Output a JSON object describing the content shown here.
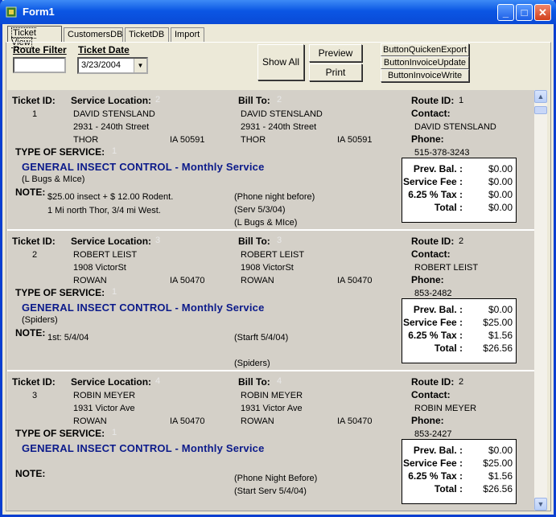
{
  "window": {
    "title": "Form1"
  },
  "tabs": [
    {
      "label": "Ticket View"
    },
    {
      "label": "CustomersDB"
    },
    {
      "label": "TicketDB"
    },
    {
      "label": "Import"
    }
  ],
  "filters": {
    "route_filter_label": "Route Filter",
    "route_filter_value": "",
    "ticket_date_label": "Ticket Date",
    "ticket_date_value": "3/23/2004"
  },
  "buttons": {
    "show_all": "Show All",
    "preview": "Preview",
    "print": "Print",
    "quicken_export": "ButtonQuickenExport",
    "invoice_update": "ButtonInvoiceUpdate",
    "invoice_write": "ButtonInvoiceWrite"
  },
  "labels": {
    "ticket_id": "Ticket ID:",
    "service_location": "Service Location:",
    "bill_to": "Bill To:",
    "route_id": "Route ID:",
    "contact": "Contact:",
    "phone": "Phone:",
    "type_of_service": "TYPE OF SERVICE:",
    "note": "NOTE:",
    "prev_bal": "Prev. Bal. :",
    "service_fee": "Service Fee :",
    "tax": "6.25 % Tax :",
    "total": "Total :"
  },
  "tickets": [
    {
      "ticket_id": "1",
      "loc_code": "2",
      "bill_code": "2",
      "route_id": "1",
      "loc_name": "DAVID STENSLAND",
      "loc_street": "2931 - 240th Street",
      "loc_city": "THOR",
      "loc_state_zip": "IA  50591",
      "bill_name": "DAVID STENSLAND",
      "bill_street": "2931 - 240th Street",
      "bill_city": "THOR",
      "bill_state_zip": "IA  50591",
      "contact": "DAVID STENSLAND",
      "phone": "515-378-3243",
      "service_code": "1",
      "service": "GENERAL INSECT CONTROL - Monthly Service",
      "pests": "(L Bugs & MIce)",
      "note_1": "$25.00 insect + $ 12.00 Rodent.",
      "note_2": "1 Mi north Thor, 3/4 mi West.",
      "note_r1": "(Phone night before)",
      "note_r2": "(Serv 5/3/04)",
      "note_r3": "(L Bugs & MIce)",
      "prev_bal": "$0.00",
      "service_fee": "$0.00",
      "tax": "$0.00",
      "total": "$0.00"
    },
    {
      "ticket_id": "2",
      "loc_code": "3",
      "bill_code": "3",
      "route_id": "2",
      "loc_name": "ROBERT LEIST",
      "loc_street": "1908 VictorSt",
      "loc_city": "ROWAN",
      "loc_state_zip": "IA  50470",
      "bill_name": "ROBERT LEIST",
      "bill_street": "1908 VictorSt",
      "bill_city": "ROWAN",
      "bill_state_zip": "IA  50470",
      "contact": "ROBERT LEIST",
      "phone": "853-2482",
      "service_code": "1",
      "service": "GENERAL INSECT CONTROL - Monthly Service",
      "pests": "(Spiders)",
      "note_1": "1st: 5/4/04",
      "note_2": "",
      "note_r1": "(Starft 5/4/04)",
      "note_r2": "",
      "note_r3": "(Spiders)",
      "prev_bal": "$0.00",
      "service_fee": "$25.00",
      "tax": "$1.56",
      "total": "$26.56"
    },
    {
      "ticket_id": "3",
      "loc_code": "4",
      "bill_code": "4",
      "route_id": "2",
      "loc_name": "ROBIN MEYER",
      "loc_street": "1931 Victor Ave",
      "loc_city": "ROWAN",
      "loc_state_zip": "IA  50470",
      "bill_name": "ROBIN MEYER",
      "bill_street": "1931 Victor Ave",
      "bill_city": "ROWAN",
      "bill_state_zip": "IA  50470",
      "contact": "ROBIN MEYER",
      "phone": "853-2427",
      "service_code": "1",
      "service": "GENERAL INSECT CONTROL - Monthly Service",
      "pests": "",
      "note_1": "",
      "note_2": "",
      "note_r1": "(Phone Night Before)",
      "note_r2": "(Start Serv 5/4/04)",
      "note_r3": "",
      "prev_bal": "$0.00",
      "service_fee": "$25.00",
      "tax": "$1.56",
      "total": "$26.56"
    }
  ]
}
